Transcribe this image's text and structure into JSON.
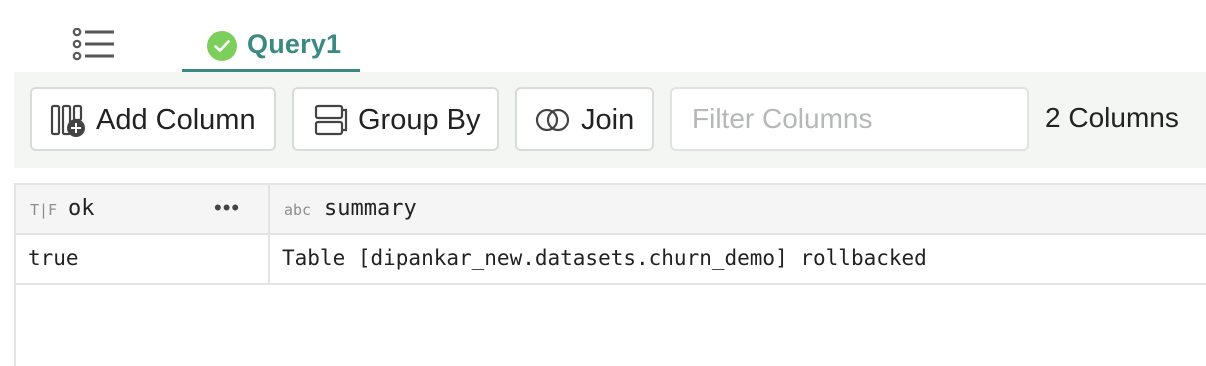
{
  "tabs": {
    "list_icon": "list-icon",
    "active_tab": {
      "label": "Query1",
      "status_icon": "check-circle-icon",
      "status_color": "#7ccf5a",
      "accent": "#3a8a82"
    }
  },
  "toolbar": {
    "add_column_label": "Add Column",
    "group_by_label": "Group By",
    "join_label": "Join",
    "filter_placeholder": "Filter Columns",
    "filter_value": "",
    "column_count": "2 Columns"
  },
  "table": {
    "columns": [
      {
        "type_tag": "T|F",
        "name": "ok",
        "menu": "•••"
      },
      {
        "type_tag": "abc",
        "name": "summary"
      }
    ],
    "rows": [
      {
        "ok": "true",
        "summary": "Table [dipankar_new.datasets.churn_demo] rollbacked"
      }
    ]
  }
}
